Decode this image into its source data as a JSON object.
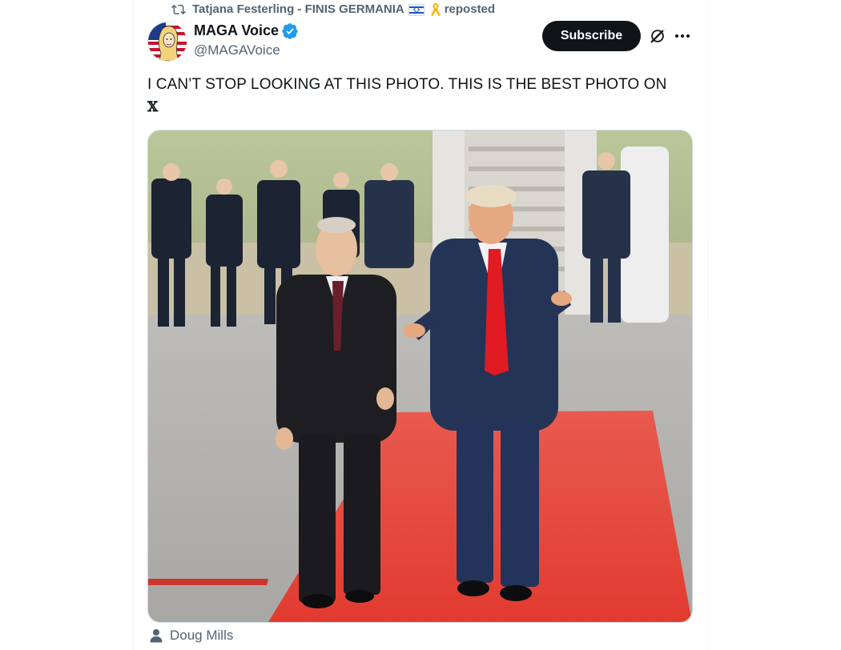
{
  "repost": {
    "reposter_name": "Tatjana Festerling - FINIS GERMANIA",
    "label": "reposted"
  },
  "author": {
    "name": "MAGA Voice",
    "handle": "@MAGAVoice",
    "verified": true
  },
  "actions": {
    "subscribe_label": "Subscribe",
    "icons": [
      "grok-icon",
      "more-icon"
    ]
  },
  "post": {
    "text": "I CAN’T STOP LOOKING AT THIS PHOTO. THIS IS THE BEST PHOTO ON",
    "text_logo": "𝕏"
  },
  "media": {
    "photo_credit": "Doug Mills"
  },
  "colors": {
    "accent": "#1d9bf0",
    "button_bg": "#0f1419",
    "secondary_text": "#536471",
    "carpet": "#e8463c"
  }
}
